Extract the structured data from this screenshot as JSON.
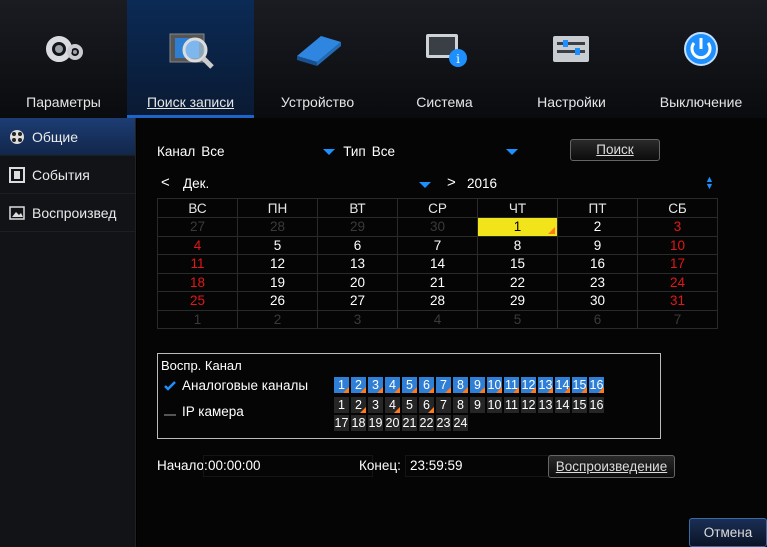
{
  "top_tabs": [
    {
      "label": "Параметры",
      "icon": "gear-icon"
    },
    {
      "label": "Поиск записи",
      "icon": "search-film-icon"
    },
    {
      "label": "Устройство",
      "icon": "hard-disk-icon"
    },
    {
      "label": "Система",
      "icon": "info-monitor-icon"
    },
    {
      "label": "Настройки",
      "icon": "settings-panel-icon"
    },
    {
      "label": "Выключение",
      "icon": "power-icon"
    }
  ],
  "sidebar": {
    "items": [
      {
        "label": "Общие",
        "icon": "film-reel-icon"
      },
      {
        "label": "События",
        "icon": "event-icon"
      },
      {
        "label": "Воспроизвед",
        "icon": "image-icon"
      }
    ]
  },
  "search": {
    "channel_label": "Канал",
    "channel_value": "Все",
    "type_label": "Тип",
    "type_value": "Все",
    "search_button": "Поиск"
  },
  "calendar": {
    "prev": "<",
    "next": ">",
    "month": "Дек.",
    "year": "2016",
    "weekdays": [
      "ВС",
      "ПН",
      "ВТ",
      "СР",
      "ЧТ",
      "ПТ",
      "СБ"
    ],
    "rows": [
      [
        "27",
        "28",
        "29",
        "30",
        "1",
        "2",
        "3"
      ],
      [
        "4",
        "5",
        "6",
        "7",
        "8",
        "9",
        "10"
      ],
      [
        "11",
        "12",
        "13",
        "14",
        "15",
        "16",
        "17"
      ],
      [
        "18",
        "19",
        "20",
        "21",
        "22",
        "23",
        "24"
      ],
      [
        "25",
        "26",
        "27",
        "28",
        "29",
        "30",
        "31"
      ],
      [
        "1",
        "2",
        "3",
        "4",
        "5",
        "6",
        "7"
      ]
    ],
    "selected_day": "1"
  },
  "playback_channels": {
    "title": "Воспр. Канал",
    "analog_label": "Аналоговые каналы",
    "analog_checked": true,
    "ip_label": "IP камера",
    "ip_checked": false,
    "analog_numbers": [
      "1",
      "2",
      "3",
      "4",
      "5",
      "6",
      "7",
      "8",
      "9",
      "10",
      "11",
      "12",
      "13",
      "14",
      "15",
      "16"
    ],
    "ip_row1": [
      "1",
      "2",
      "3",
      "4",
      "5",
      "6",
      "7",
      "8",
      "9",
      "10",
      "11",
      "12",
      "13",
      "14",
      "15",
      "16"
    ],
    "ip_row2": [
      "17",
      "18",
      "19",
      "20",
      "21",
      "22",
      "23",
      "24"
    ]
  },
  "time": {
    "start_label": "Начало:",
    "start_value": "00:00:00",
    "end_label": "Конец:",
    "end_value": "23:59:59",
    "play_button": "Воспроизведение"
  },
  "cancel_button": "Отмена",
  "colors": {
    "accent": "#1e8fff",
    "weekend": "#e01818",
    "today": "#f2e41b",
    "channel_blue": "#2f7fd6",
    "marker": "#ff7a1a"
  }
}
